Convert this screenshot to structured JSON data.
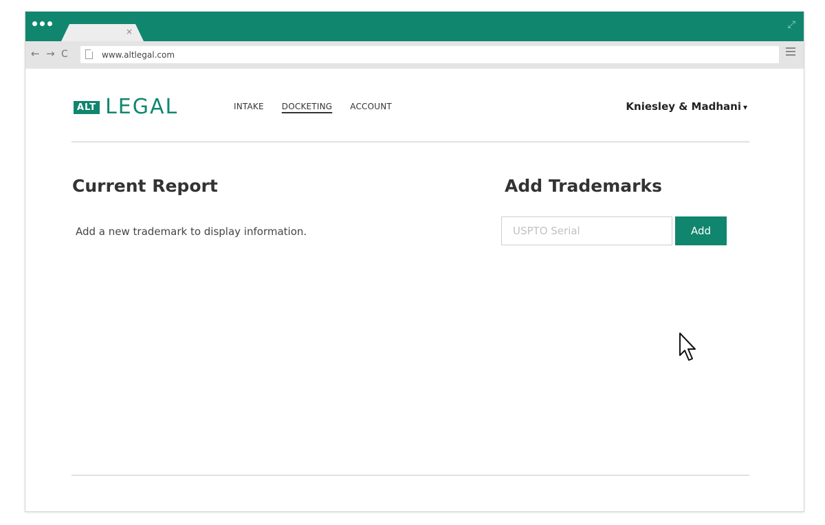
{
  "browser": {
    "url": "www.altlegal.com",
    "tab_close": "×",
    "nav": {
      "back": "←",
      "forward": "→",
      "reload": "C"
    },
    "resize_glyph": "⤢"
  },
  "header": {
    "logo_box": "ALT",
    "logo_word": "LEGAL",
    "nav_items": [
      {
        "label": "INTAKE",
        "active": false
      },
      {
        "label": "DOCKETING",
        "active": true
      },
      {
        "label": "ACCOUNT",
        "active": false
      }
    ],
    "account_name": "Kniesley & Madhani",
    "account_caret": "▾"
  },
  "report": {
    "title": "Current Report",
    "empty_message": "Add a new trademark to display information."
  },
  "add_trademarks": {
    "title": "Add Trademarks",
    "input_placeholder": "USPTO Serial",
    "input_value": "",
    "button_label": "Add"
  },
  "colors": {
    "brand": "#10866e",
    "toolbar": "#e4e4e4"
  },
  "icons": {
    "dots": "window-dots-icon",
    "page": "page-icon",
    "menu": "hamburger-menu-icon",
    "cursor": "mouse-cursor-icon"
  }
}
